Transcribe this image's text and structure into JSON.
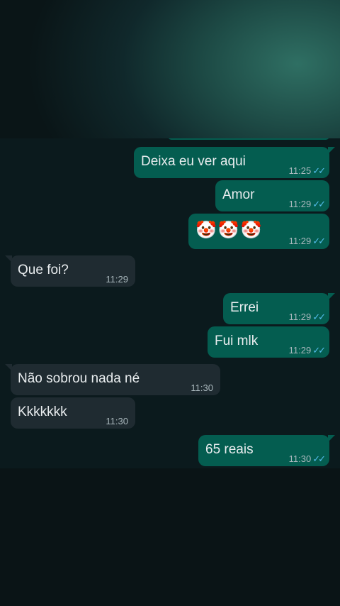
{
  "messages": [
    {
      "dir": "out",
      "text": "Deixa eu ver aqui",
      "time": "11:25",
      "ticks": "✓✓"
    },
    {
      "dir": "out",
      "text": "Amor",
      "time": "11:29",
      "ticks": "✓✓"
    },
    {
      "dir": "out",
      "text": "🤡🤡🤡",
      "time": "11:29",
      "ticks": "✓✓"
    },
    {
      "dir": "in",
      "text": "Que foi?",
      "time": "11:29"
    },
    {
      "dir": "out",
      "text": "Errei",
      "time": "11:29",
      "ticks": "✓✓"
    },
    {
      "dir": "out",
      "text": "Fui mlk",
      "time": "11:29",
      "ticks": "✓✓"
    },
    {
      "dir": "in",
      "text": "Não sobrou nada né",
      "time": "11:30"
    },
    {
      "dir": "in",
      "text": "Kkkkkkk",
      "time": "11:30"
    },
    {
      "dir": "out",
      "text": "65 reais",
      "time": "11:30",
      "ticks": "✓✓"
    }
  ],
  "colors": {
    "outgoing_bubble": "#045d50",
    "incoming_bubble": "#1f2b31",
    "read_ticks": "#53bdeb",
    "chat_background": "#0b1a1d"
  }
}
